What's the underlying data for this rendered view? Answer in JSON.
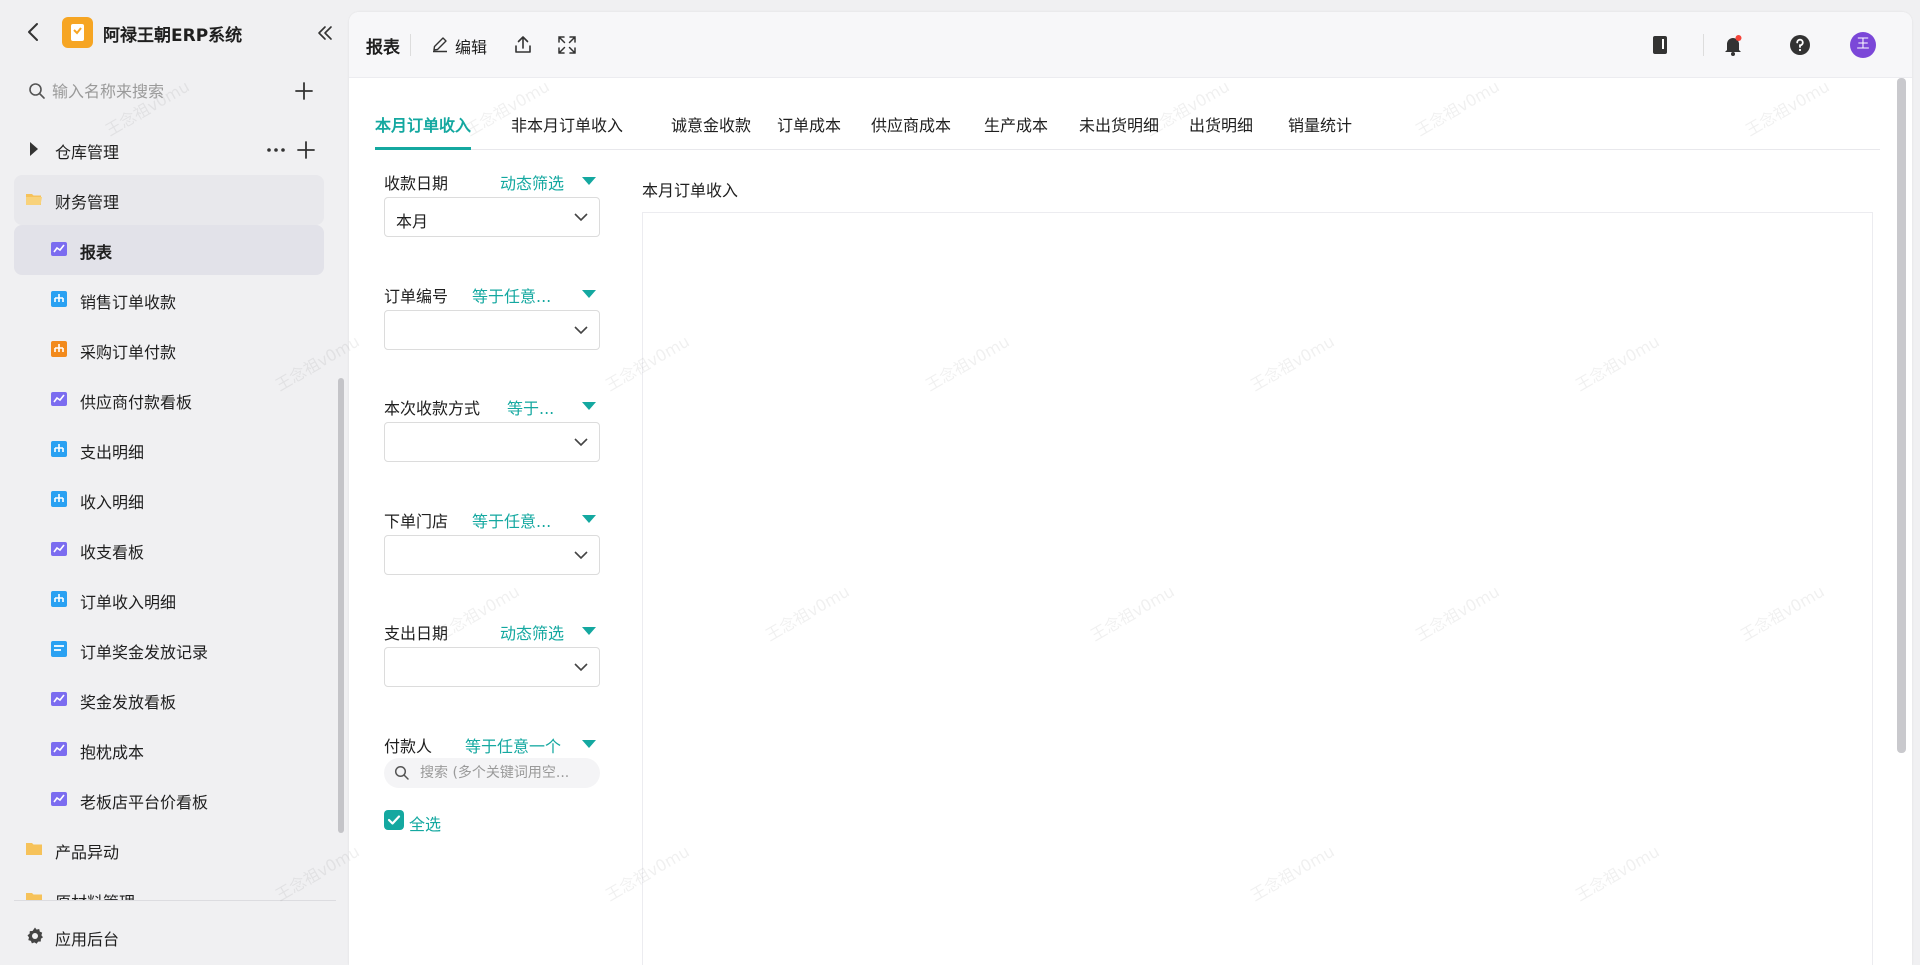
{
  "app": {
    "name": "阿禄王朝ERP系统"
  },
  "sidebar": {
    "search_placeholder": "输入名称来搜索",
    "groups": [
      {
        "label": "仓库管理"
      },
      {
        "label": "财务管理"
      },
      {
        "label": "产品异动"
      },
      {
        "label": "原材料管理"
      }
    ],
    "items": [
      {
        "label": "报表",
        "icon": "chart-icon"
      },
      {
        "label": "销售订单收款",
        "icon": "sheet-icon"
      },
      {
        "label": "采购订单付款",
        "icon": "sheet-icon"
      },
      {
        "label": "供应商付款看板",
        "icon": "chart-icon"
      },
      {
        "label": "支出明细",
        "icon": "sheet-icon"
      },
      {
        "label": "收入明细",
        "icon": "sheet-icon"
      },
      {
        "label": "收支看板",
        "icon": "chart-icon"
      },
      {
        "label": "订单收入明细",
        "icon": "sheet-icon"
      },
      {
        "label": "订单奖金发放记录",
        "icon": "form-icon"
      },
      {
        "label": "奖金发放看板",
        "icon": "chart-icon"
      },
      {
        "label": "抱枕成本",
        "icon": "chart-icon"
      },
      {
        "label": "老板店平台价看板",
        "icon": "chart-icon"
      }
    ],
    "footer_label": "应用后台"
  },
  "topbar": {
    "title": "报表",
    "edit_label": "编辑",
    "avatar_text": "王"
  },
  "tabs": [
    {
      "label": "本月订单收入",
      "active": true
    },
    {
      "label": "非本月订单收入"
    },
    {
      "label": "诚意金收款"
    },
    {
      "label": "订单成本"
    },
    {
      "label": "供应商成本"
    },
    {
      "label": "生产成本"
    },
    {
      "label": "未出货明细"
    },
    {
      "label": "出货明细"
    },
    {
      "label": "销量统计"
    }
  ],
  "filters": [
    {
      "label": "收款日期",
      "mode": "动态筛选",
      "value": "本月"
    },
    {
      "label": "订单编号",
      "mode": "等于任意...",
      "value": ""
    },
    {
      "label": "本次收款方式",
      "mode": "等于...",
      "value": ""
    },
    {
      "label": "下单门店",
      "mode": "等于任意...",
      "value": ""
    },
    {
      "label": "支出日期",
      "mode": "动态筛选",
      "value": ""
    },
    {
      "label": "付款人",
      "mode": "等于任意一个",
      "search_placeholder": "搜索 (多个关键词用空...",
      "select_all_label": "全选"
    }
  ],
  "chart": {
    "title": "本月订单收入"
  },
  "watermark": "王念祖v0mu",
  "colors": {
    "accent": "#14a8a0",
    "logo": "#f6a523",
    "avatar": "#7b47d8",
    "chart_icon": "#7b6cf0",
    "sheet_icon": "#2aa1f2",
    "sheet_icon_orange": "#f28a1c"
  }
}
